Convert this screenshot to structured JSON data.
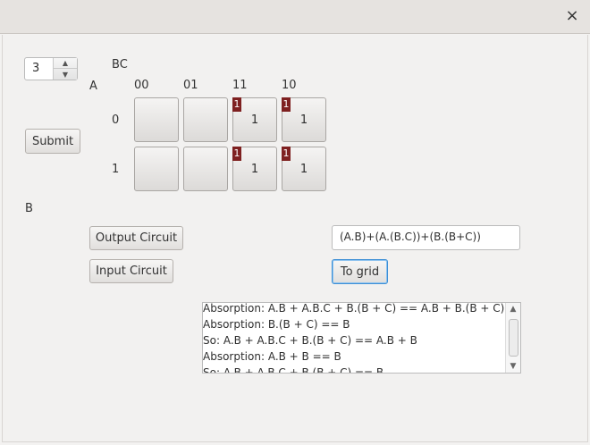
{
  "window": {
    "close_icon": "×"
  },
  "spinner": {
    "value": "3",
    "up_icon": "▲",
    "down_icon": "▼"
  },
  "buttons": {
    "submit": "Submit",
    "output_circuit": "Output Circuit",
    "input_circuit": "Input Circuit",
    "to_grid": "To grid"
  },
  "kmap": {
    "bc_label": "BC",
    "a_label": "A",
    "col_headers": [
      "00",
      "01",
      "11",
      "10"
    ],
    "row_headers": [
      "0",
      "1"
    ],
    "rows": [
      [
        {
          "value": "",
          "flag": ""
        },
        {
          "value": "",
          "flag": ""
        },
        {
          "value": "1",
          "flag": "1"
        },
        {
          "value": "1",
          "flag": "1"
        }
      ],
      [
        {
          "value": "",
          "flag": ""
        },
        {
          "value": "",
          "flag": ""
        },
        {
          "value": "1",
          "flag": "1"
        },
        {
          "value": "1",
          "flag": "1"
        }
      ]
    ]
  },
  "result_label": "B",
  "expression": "(A.B)+(A.(B.C))+(B.(B+C))",
  "log": [
    "Absorption: A.B + A.B.C + B.(B + C) == A.B + B.(B + C)",
    "Absorption: B.(B + C) == B",
    "So: A.B + A.B.C + B.(B + C) == A.B + B",
    "Absorption: A.B + B == B",
    "So: A.B + A.B.C + B.(B + C) == B"
  ],
  "colors": {
    "flag": "#7e2020",
    "focus": "#3d8fd6"
  }
}
